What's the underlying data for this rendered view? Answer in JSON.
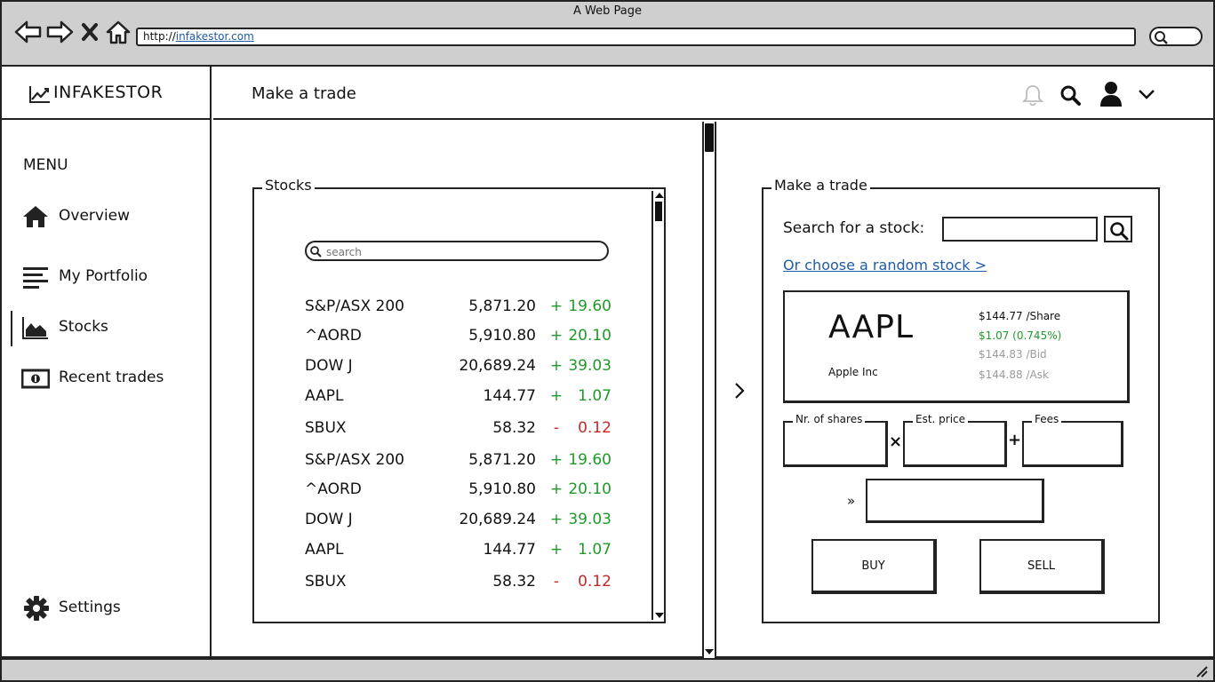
{
  "browser": {
    "window_title": "A Web Page",
    "url_prefix": "http://",
    "url_host": "infakestor.com"
  },
  "app": {
    "logo_text": "INFAKESTOR",
    "page_title": "Make a trade"
  },
  "sidebar": {
    "menu_label": "MENU",
    "items": [
      {
        "label": "Overview",
        "icon": "home-icon"
      },
      {
        "label": "My Portfolio",
        "icon": "list-icon"
      },
      {
        "label": "Stocks",
        "icon": "area-chart-icon",
        "active": true
      },
      {
        "label": "Recent trades",
        "icon": "money-icon"
      }
    ],
    "settings_label": "Settings"
  },
  "stocks_panel": {
    "title": "Stocks",
    "search_placeholder": "search",
    "rows": [
      {
        "symbol": "S&P/ASX 200",
        "price": "5,871.20",
        "sign": "+",
        "change": "19.60",
        "direction": "up"
      },
      {
        "symbol": "^AORD",
        "price": "5,910.80",
        "sign": "+",
        "change": "20.10",
        "direction": "up"
      },
      {
        "symbol": "DOW J",
        "price": "20,689.24",
        "sign": "+",
        "change": "39.03",
        "direction": "up"
      },
      {
        "symbol": "AAPL",
        "price": "144.77",
        "sign": "+",
        "change": "1.07",
        "direction": "up"
      },
      {
        "symbol": "SBUX",
        "price": "58.32",
        "sign": "-",
        "change": "0.12",
        "direction": "down"
      },
      {
        "symbol": "S&P/ASX 200",
        "price": "5,871.20",
        "sign": "+",
        "change": "19.60",
        "direction": "up"
      },
      {
        "symbol": "^AORD",
        "price": "5,910.80",
        "sign": "+",
        "change": "20.10",
        "direction": "up"
      },
      {
        "symbol": "DOW J",
        "price": "20,689.24",
        "sign": "+",
        "change": "39.03",
        "direction": "up"
      },
      {
        "symbol": "AAPL",
        "price": "144.77",
        "sign": "+",
        "change": "1.07",
        "direction": "up"
      },
      {
        "symbol": "SBUX",
        "price": "58.32",
        "sign": "-",
        "change": "0.12",
        "direction": "down"
      }
    ]
  },
  "trade_panel": {
    "title": "Make a trade",
    "search_label": "Search for a stock:",
    "search_value": "",
    "random_link": "Or choose a random stock >",
    "quote": {
      "ticker": "AAPL",
      "company": "Apple Inc",
      "share_price": "$144.77 /Share",
      "change": "$1.07 (0.745%)",
      "bid": "$144.83 /Bid",
      "ask": "$144.88 /Ask"
    },
    "fields": {
      "shares_label": "Nr. of shares",
      "price_label": "Est. price",
      "fees_label": "Fees",
      "multiply": "×",
      "plus": "+",
      "result_arrow": "»"
    },
    "buy_label": "BUY",
    "sell_label": "SELL"
  },
  "colors": {
    "up": "#1f9a2a",
    "down": "#c62828",
    "link": "#1f5aa8",
    "muted": "#9a9a9a",
    "chrome": "#cfcfcf"
  }
}
